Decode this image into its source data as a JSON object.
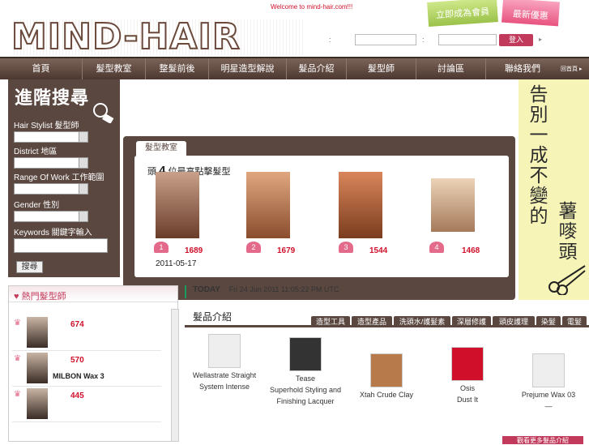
{
  "header": {
    "welcome": "Welcome to mind-hair.com!!!",
    "logo": "MIND-HAIR",
    "member_label": "立即成為會員",
    "offer_label": "最新優惠",
    "login_sep1": ":",
    "login_sep2": ":",
    "login_button": "登入",
    "login_arrow": "▸"
  },
  "nav": {
    "items": [
      "首頁",
      "髮型教室",
      "整髮前後",
      "明星造型解說",
      "髮品介紹",
      "髮型師",
      "討論區",
      "聯絡我們"
    ],
    "extra": "回首頁 ▸"
  },
  "search": {
    "title": "進階搜尋",
    "fields": [
      "Hair Stylist 髮型師",
      "District 地區",
      "Range Of Work 工作範圍",
      "Gender 性別",
      "Keywords 關鍵字輸入"
    ],
    "button": "搜尋"
  },
  "banner": {
    "col1": "告別一成不變的",
    "col2": "薯嘜頭"
  },
  "classroom": {
    "tab": "髮型教室",
    "title_prefix": "頭",
    "title_num": "4",
    "title_suffix": "位最高點擊髮型",
    "items": [
      {
        "rank": "1",
        "score": "1689"
      },
      {
        "rank": "2",
        "score": "1679"
      },
      {
        "rank": "3",
        "score": "1544"
      },
      {
        "rank": "4",
        "score": "1468"
      }
    ],
    "date": "2011-05-17"
  },
  "hot": {
    "title": "熱門髮型師",
    "rows": [
      {
        "score": "674",
        "name": ""
      },
      {
        "score": "570",
        "name": "MILBON Wax 3"
      },
      {
        "score": "445",
        "name": ""
      }
    ]
  },
  "today": {
    "label": "TODAY",
    "datetime": "Fri 24 Jun 2011 11:05:22 PM UTC"
  },
  "products": {
    "title": "髮品介紹",
    "tabs": [
      "造型工具",
      "造型產品",
      "洗頭水/護髮素",
      "深層修護",
      "頭皮護理",
      "染髮",
      "電髮"
    ],
    "items": [
      {
        "line1": "Wellastrate Straight",
        "line2": "System Intense",
        "line3": ""
      },
      {
        "line1": "Tease",
        "line2": "Superhold Styling and",
        "line3": "Finishing Lacquer"
      },
      {
        "line1": "Xtah Crude Clay",
        "line2": "",
        "line3": ""
      },
      {
        "line1": "Osis",
        "line2": "Dust It",
        "line3": ""
      },
      {
        "line1": "Prejume Wax 03",
        "line2": "—",
        "line3": ""
      }
    ],
    "more": "觀看更多髮品介紹"
  }
}
